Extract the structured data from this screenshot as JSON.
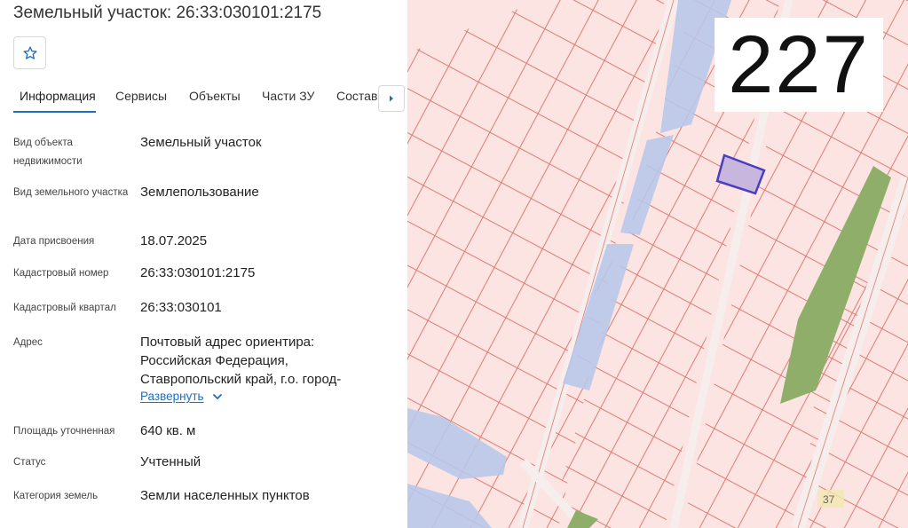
{
  "header": {
    "title": "Земельный участок: 26:33:030101:2175"
  },
  "favorite": {
    "icon": "star-outline-icon"
  },
  "tabs": [
    {
      "label": "Информация",
      "active": true
    },
    {
      "label": "Сервисы"
    },
    {
      "label": "Объекты"
    },
    {
      "label": "Части ЗУ"
    },
    {
      "label": "Состав"
    }
  ],
  "tab_scroll_icon": "caret-right-icon",
  "info": {
    "object_type_label": "Вид объекта недвижимости",
    "object_type_value": "Земельный участок",
    "land_type_label": "Вид земельного участка",
    "land_type_value": "Землепользование",
    "assign_date_label": "Дата присвоения",
    "assign_date_value": "18.07.2025",
    "cadastral_number_label": "Кадастровый номер",
    "cadastral_number_value": "26:33:030101:2175",
    "cadastral_quarter_label": "Кадастровый квартал",
    "cadastral_quarter_value": "26:33:030101",
    "address_label": "Адрес",
    "address_line1": "Почтовый адрес ориентира:",
    "address_line2": "Российская Федерация,",
    "address_line3": "Ставропольский край, г.о. город-",
    "expand_label": "Развернуть",
    "area_label": "Площадь уточненная",
    "area_value": "640 кв. м",
    "status_label": "Статус",
    "status_value": "Учтенный",
    "category_label": "Категория земель",
    "category_value": "Земли населенных пунктов"
  },
  "map": {
    "overlay_number": "227",
    "house_number": "37",
    "colors": {
      "background": "#fbe4e2",
      "parcel_line": "#e07a72",
      "water": "#b9c6ea",
      "green": "#8fae6a",
      "selected_fill": "#c8b6df",
      "selected_stroke": "#4a3fc0"
    }
  }
}
